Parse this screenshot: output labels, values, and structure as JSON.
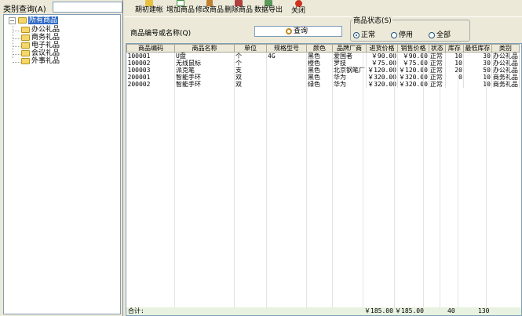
{
  "left": {
    "search_label": "类别查询(A)",
    "search_value": "",
    "tree": {
      "root": "所有商品",
      "children": [
        "办公礼品",
        "商务礼品",
        "电子礼品",
        "会议礼品",
        "外事礼品"
      ]
    }
  },
  "toolbar": {
    "buttons": [
      {
        "label": "期初建帐",
        "icon": "folder-open-icon",
        "color": "#e8c040"
      },
      {
        "label": "增加商品",
        "icon": "add-page-icon",
        "color": "#3a8f3a"
      },
      {
        "label": "修改商品",
        "icon": "edit-pencil-icon",
        "color": "#c08030"
      },
      {
        "label": "删除商品",
        "icon": "delete-icon",
        "color": "#b04040"
      },
      {
        "label": "数据导出",
        "icon": "export-icon",
        "color": "#5a9a5a"
      },
      {
        "label": "关闭",
        "icon": "close-icon",
        "color": "#d03020"
      }
    ]
  },
  "filter": {
    "keyword_label": "商品编号或名称(Q)",
    "keyword_value": "",
    "query_label": "查询",
    "status_title": "商品状态(S)",
    "status_options": [
      "正常",
      "停用",
      "全部"
    ],
    "status_selected": "正常"
  },
  "grid": {
    "columns": [
      "商品编码",
      "商品名称",
      "单位",
      "规格型号",
      "颜色",
      "品牌厂商",
      "进货价格",
      "销售价格",
      "状态",
      "库存",
      "最低库存",
      "类别"
    ],
    "rows": [
      [
        "100001",
        "U盘",
        "个",
        "4G",
        "黑色",
        "爱国者",
        "￥90.00",
        "￥90.00",
        "正常",
        "10",
        "30",
        "办公礼品"
      ],
      [
        "100002",
        "无线鼠标",
        "个",
        "",
        "橙色",
        "罗技",
        "￥75.00",
        "￥75.00",
        "正常",
        "10",
        "30",
        "办公礼品"
      ],
      [
        "100003",
        "派克笔",
        "支",
        "",
        "黑色",
        "北京钢笔厂",
        "￥120.00",
        "￥120.00",
        "正常",
        "20",
        "50",
        "办公礼品"
      ],
      [
        "200001",
        "智能手环",
        "双",
        "",
        "黑色",
        "华为",
        "￥320.00",
        "￥320.00",
        "正常",
        "0",
        "10",
        "商务礼品"
      ],
      [
        "200002",
        "智能手环",
        "双",
        "",
        "绿色",
        "华为",
        "￥320.00",
        "￥320.00",
        "正常",
        "",
        "10",
        "商务礼品"
      ]
    ],
    "footer": {
      "label": "合计:",
      "purchase_total": "￥185.00",
      "sale_total": "￥185.00",
      "stock_total": "40",
      "min_stock_total": "130"
    }
  }
}
